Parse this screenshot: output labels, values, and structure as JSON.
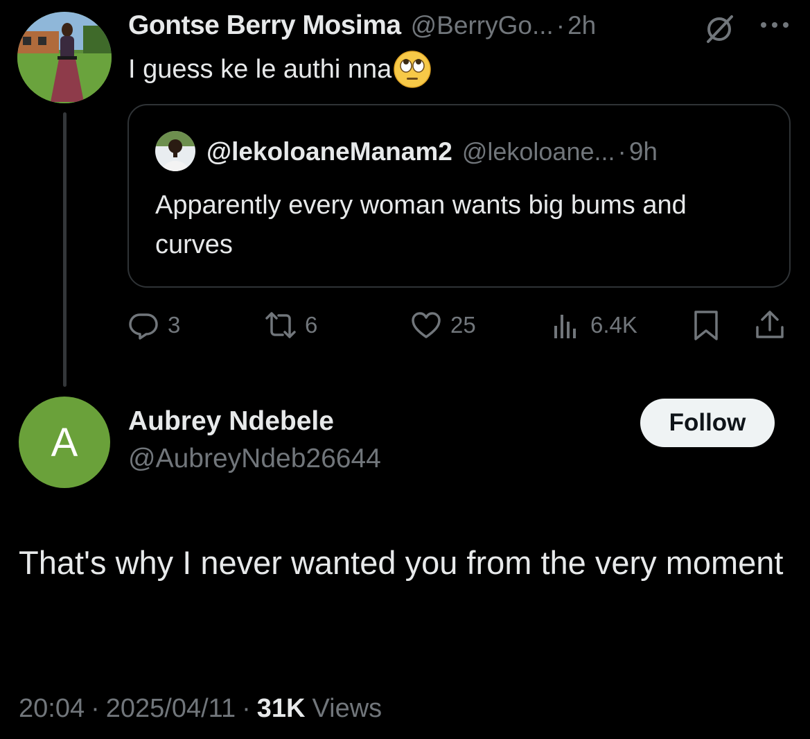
{
  "parent_tweet": {
    "author_name": "Gontse Berry Mosima",
    "author_handle": "@BerryGo...",
    "separator": "·",
    "time": "2h",
    "text": "I guess ke le authi nna",
    "emoji": "face-with-rolling-eyes",
    "icons": [
      "grok-icon",
      "more-icon"
    ]
  },
  "quoted_tweet": {
    "author_name": "@lekoloaneManam2",
    "author_handle": "@lekoloane...",
    "separator": "·",
    "time": "9h",
    "text": "Apparently every woman wants big bums and curves"
  },
  "actions": {
    "replies": "3",
    "reposts": "6",
    "likes": "25",
    "views": "6.4K",
    "icons": [
      "reply-icon",
      "repost-icon",
      "like-icon",
      "views-icon",
      "bookmark-icon",
      "share-icon"
    ]
  },
  "reply_tweet": {
    "avatar_letter": "A",
    "avatar_color": "#6aa13a",
    "author_name": "Aubrey Ndebele",
    "author_handle": "@AubreyNdeb26644",
    "follow_label": "Follow",
    "text": "That's why I never wanted you from the very moment",
    "time": "20:04",
    "separator": "·",
    "date": "2025/04/11",
    "views_count": "31K",
    "views_label": "Views"
  },
  "colors": {
    "background": "#000000",
    "primary_text": "#e7e9ea",
    "secondary_text": "#71767b",
    "border": "#2f3336"
  }
}
